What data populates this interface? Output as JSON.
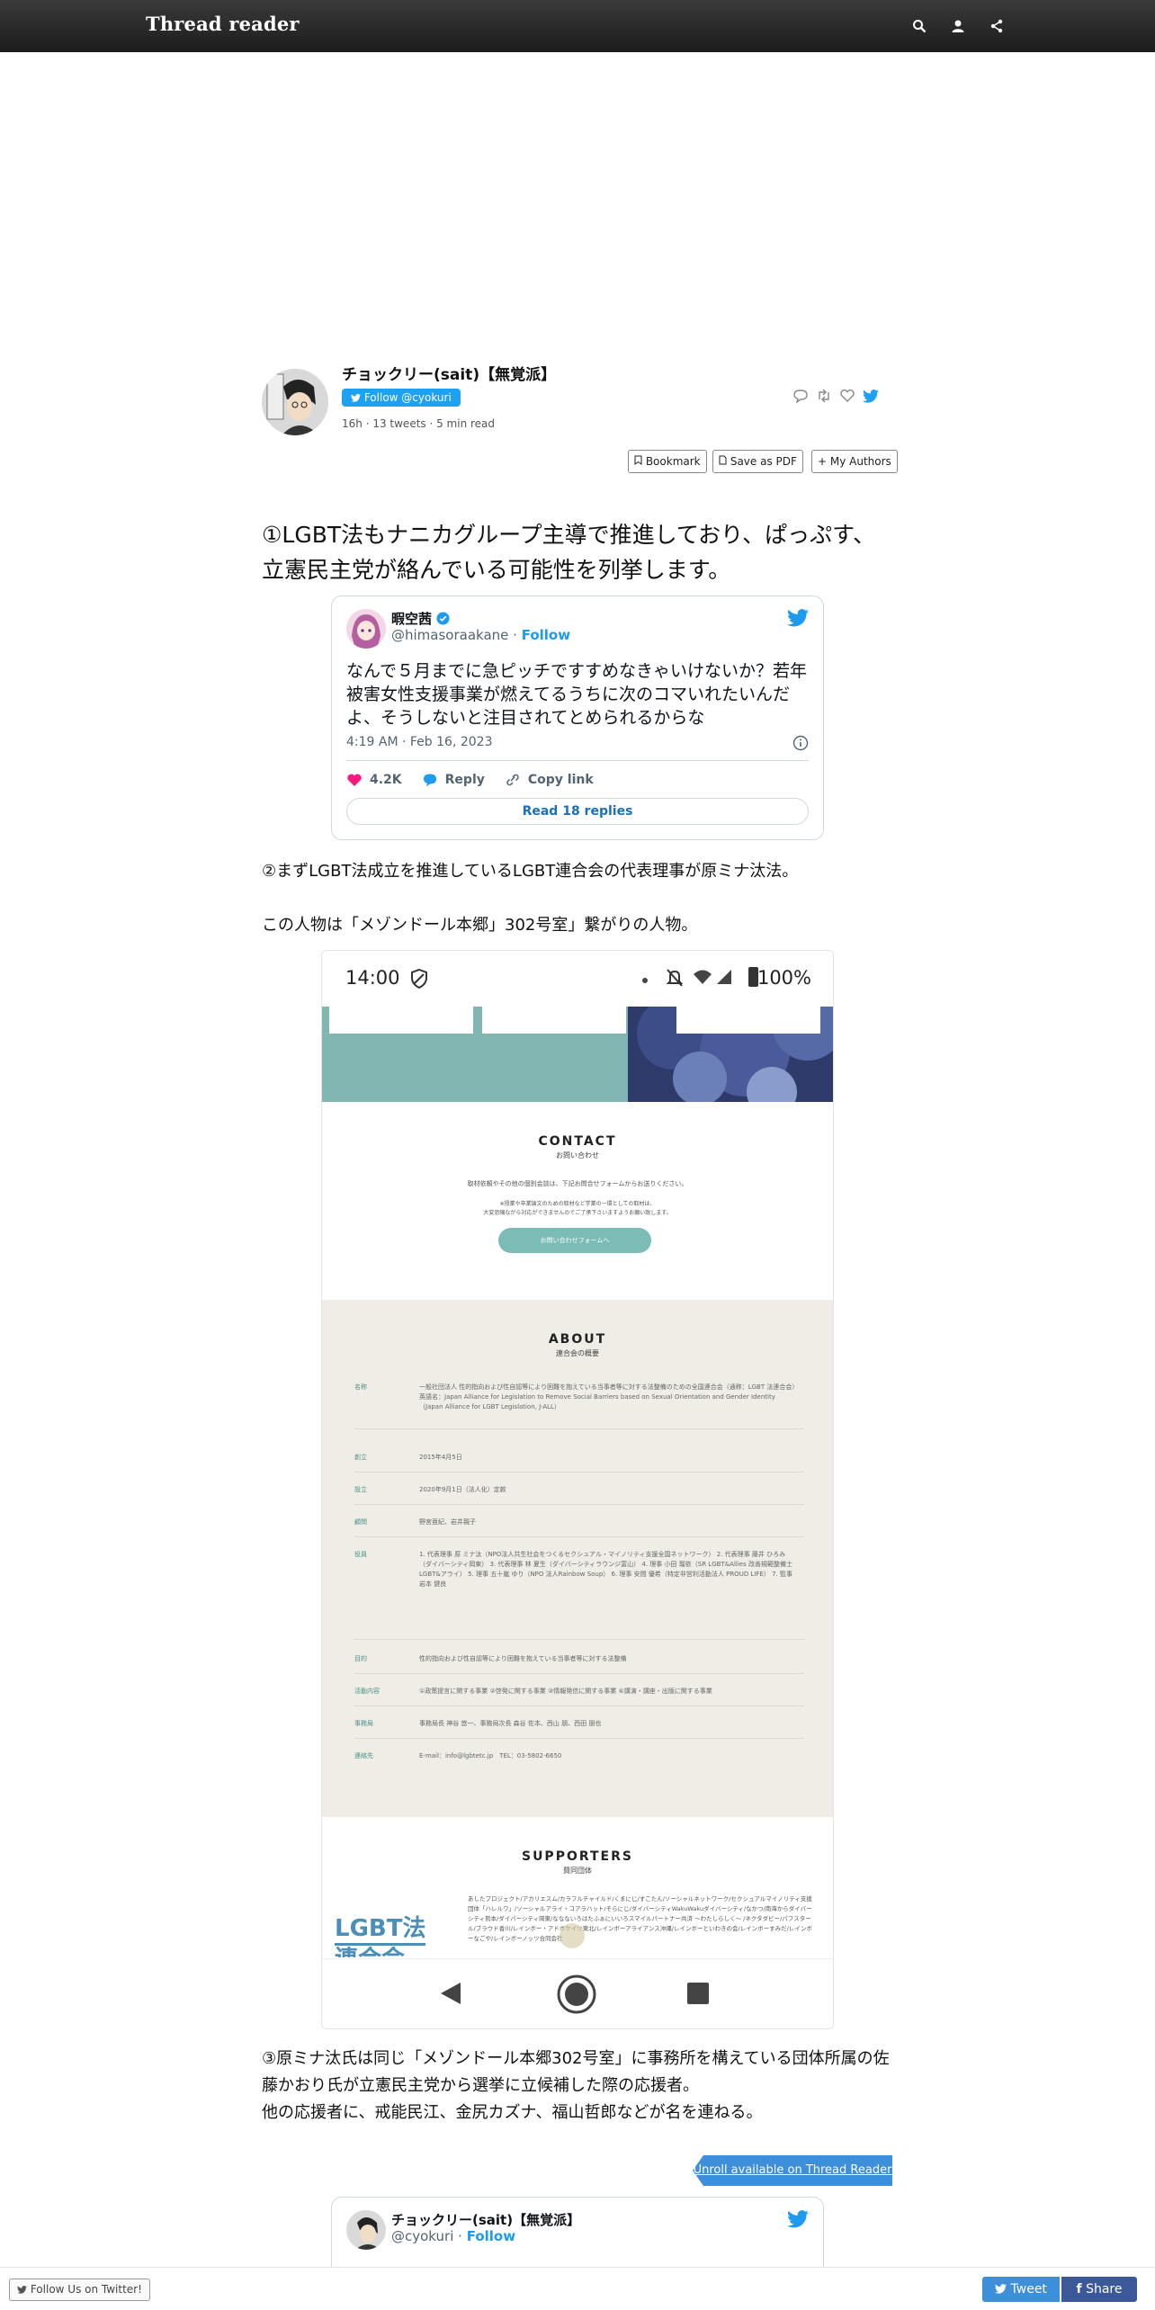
{
  "header": {
    "brand": "Thread reader"
  },
  "author": {
    "name": "チョックリー(sait)【無覚派】",
    "follow_label": "Follow @cyokuri",
    "time": "16h",
    "tweets": "13 tweets",
    "read": "5 min read"
  },
  "tools": {
    "bookmark": "Bookmark",
    "pdf": "Save as PDF",
    "authors": "My Authors"
  },
  "thread": {
    "t1": "①LGBT法もナニカグループ主導で推進しており、ぱっぷす、立憲民主党が絡んでいる可能性を列挙します。",
    "t2": "②まずLGBT法成立を推進しているLGBT連合会の代表理事が原ミナ汰法。",
    "t2b": "この人物は「メゾンドール本郷」302号室」繋がりの人物。",
    "t3a": "③原ミナ汰氏は同じ「メゾンドール本郷302号室」に事務所を構えている団体所属の佐藤かおり氏が立憲民主党から選挙に立候補した際の応援者。",
    "t3b": "他の応援者に、戒能民江、金尻カズナ、福山哲郎などが名を連ねる。"
  },
  "embed1": {
    "name": "暇空茜",
    "handle": "@himasoraakane",
    "follow": "Follow",
    "text": "なんで５月までに急ピッチですすめなきゃいけないか？若年被害女性支援事業が燃えてるうちに次のコマいれたいんだよ、そうしないと注目されてとめられるからな",
    "time": "4:19 AM · Feb 16, 2023",
    "likes": "4.2K",
    "reply": "Reply",
    "copy": "Copy link",
    "read_replies": "Read 18 replies"
  },
  "phone": {
    "time": "14:00",
    "battery": "100%",
    "contact_title": "CONTACT",
    "contact_sub": "お問い合わせ",
    "contact_text": "取材依頼やその他の個別会談は、下記お問合せフォームからお送りください。",
    "contact_note1": "※授業や卒業論文のための取材など学業の一環としての取材は、",
    "contact_note2": "大変恐縮ながら対応ができませんのでご了承下さいますようお願い致します。",
    "contact_btn": "お問い合わせフォームへ",
    "about_title": "ABOUT",
    "about_sub": "連合会の概要",
    "about_rows": [
      {
        "k": "名称",
        "v": "一般社団法人 性的指向および性自認等により困難を抱えている当事者等に対する法整備のための全国連合会（通称：LGBT 法連合会）英語名：Japan Alliance for Legislation to Remove Social Barriers based on Sexual Orientation and Gender Identity （Japan Alliance for LGBT Legislation, J-ALL）"
      },
      {
        "k": "創立",
        "v": "2015年4月5日"
      },
      {
        "k": "設立",
        "v": "2020年9月1日（法人化）定款"
      },
      {
        "k": "顧問",
        "v": "野宮亜紀、岩井親子"
      },
      {
        "k": "役員",
        "v": "1. 代表理事 原 ミナ汰（NPO法人共生社会をつくるセクシュアル・マイノリティ支援全国ネットワーク） 2. 代表理事 藤井 ひろみ（ダイバーシティ岡東） 3. 代表理事 林 夏生（ダイバーシティラウンジ富山） 4. 理事 小田 瑠依（SR LGBT&Allies 改善規範整備士LGBT&アライ） 5. 理事 五十嵐 ゆり（NPO 法人Rainbow Soup） 6. 理事 安間 優希（特定非営利活動法人 PROUD LIFE） 7. 監事 岩本 健良"
      },
      {
        "k": "目的",
        "v": "性的指向および性自認等により困難を抱えている当事者等に対する法整備"
      },
      {
        "k": "活動内容",
        "v": "①政策提言に関する事業 ②啓発に関する事業 ③情報発信に関する事業 ④講演・講座・出版に関する事業"
      },
      {
        "k": "事務局",
        "v": "事務局長 神谷 悠一、事務局次長 森谷 佐本、西山 朋、西田 朋也"
      },
      {
        "k": "連絡先",
        "v": "E-mail：info@lgbtetc.jp　TEL：03-5802-6650"
      }
    ],
    "supp_title": "SUPPORTERS",
    "supp_sub": "賛同団体",
    "supp_logo": "LGBT法",
    "supp_logo2": "連合会",
    "supp_text": "あしたプロジェクト/アカリエスム/カラフルチャイルド/くまにじ/すこたん/ソーシャルネットワーク/セクシュアルマイノリティ支援団体「ハレルワ」/ソーシャルアライ・コアラハット/そらにじ/ダイバーシティWakuWakuダイバーシティ/なかつ/南海からダイバーシティ熊本/ダイバーシティ岡東/ななないろはたふぁにいいろスマイルパートナー共済 ～わたしらしく～ /ネクタダビー/パフスタール/ブラウド香川/レインボー・アドボケイツ東北/レインボーアライアンス沖縄/レインボーといわきの会/レインボーすみだ/レインボーなごや/レインボーノッツ合同会社"
  },
  "embed2": {
    "name": "チョックリー(sait)【無覚派】",
    "handle": "@cyokuri",
    "follow": "Follow"
  },
  "unroll": "Unroll available on Thread Reader",
  "footer": {
    "follow_us": "Follow Us on Twitter!",
    "tweet": "Tweet",
    "share": "Share"
  },
  "colors": {
    "twitter_blue": "#1da1f2",
    "link_blue": "#1d6fb8",
    "like_pink": "#f91880",
    "fb_blue": "#3b5998"
  }
}
